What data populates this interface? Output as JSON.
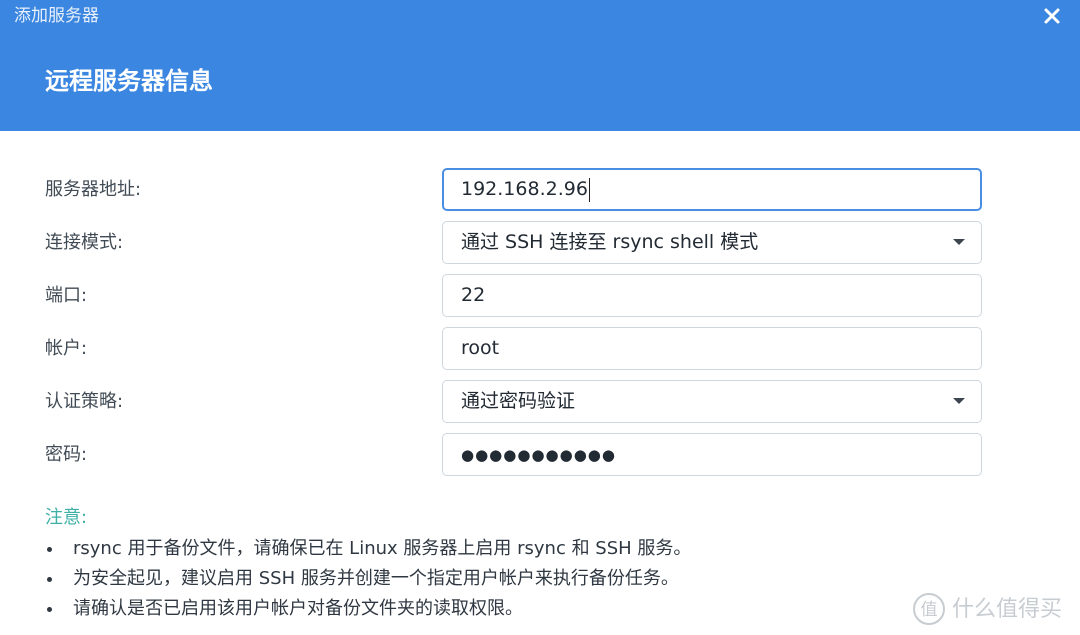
{
  "window": {
    "title": "添加服务器",
    "close_icon": "close-icon"
  },
  "header": {
    "section_title": "远程服务器信息",
    "background": "#3a86e0"
  },
  "form": {
    "server_address": {
      "label": "服务器地址:",
      "value": "192.168.2.96"
    },
    "connection_mode": {
      "label": "连接模式:",
      "value": "通过 SSH 连接至 rsync shell 模式"
    },
    "port": {
      "label": "端口:",
      "value": "22"
    },
    "account": {
      "label": "帐户:",
      "value": "root"
    },
    "auth_policy": {
      "label": "认证策略:",
      "value": "通过密码验证"
    },
    "password": {
      "label": "密码:",
      "value": "●●●●●●●●●●●"
    }
  },
  "notes": {
    "title": "注意:",
    "title_color": "#3cb0a6",
    "items": [
      "rsync 用于备份文件，请确保已在 Linux 服务器上启用 rsync 和 SSH 服务。",
      "为安全起见，建议启用 SSH 服务并创建一个指定用户帐户来执行备份任务。",
      "请确认是否已启用该用户帐户对备份文件夹的读取权限。"
    ]
  },
  "watermark": {
    "text": "什么值得买",
    "logo_icon": "smzdm-logo-icon"
  }
}
